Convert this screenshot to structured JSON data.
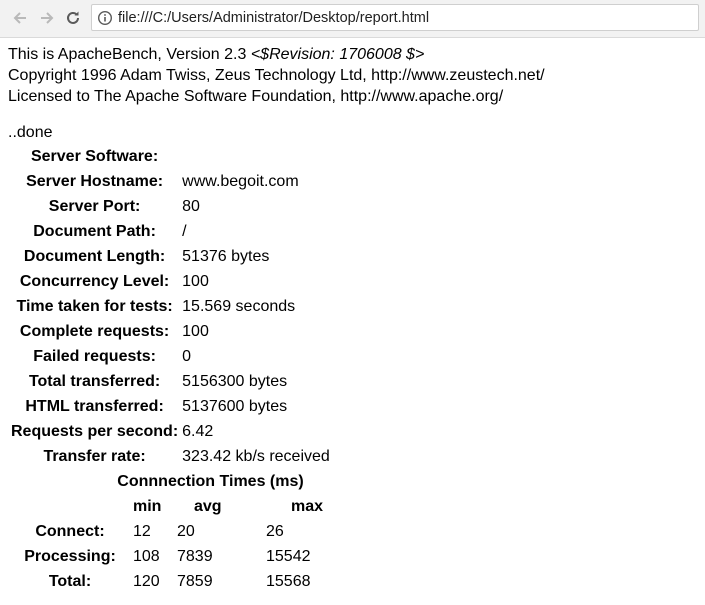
{
  "browser": {
    "url": "file:///C:/Users/Administrator/Desktop/report.html"
  },
  "banner": {
    "line1_prefix": "This is ApacheBench, Version 2.3",
    "revision": "<$Revision: 1706008 $>",
    "line2": "Copyright 1996 Adam Twiss, Zeus Technology Ltd, http://www.zeustech.net/",
    "line3": "Licensed to The Apache Software Foundation, http://www.apache.org/"
  },
  "done": "..done",
  "stats": [
    {
      "label": "Server Software:",
      "value": ""
    },
    {
      "label": "Server Hostname:",
      "value": "www.begoit.com"
    },
    {
      "label": "Server Port:",
      "value": "80"
    },
    {
      "label": "Document Path:",
      "value": "/"
    },
    {
      "label": "Document Length:",
      "value": "51376 bytes"
    },
    {
      "label": "Concurrency Level:",
      "value": "100"
    },
    {
      "label": "Time taken for tests:",
      "value": "15.569 seconds"
    },
    {
      "label": "Complete requests:",
      "value": "100"
    },
    {
      "label": "Failed requests:",
      "value": "0"
    },
    {
      "label": "Total transferred:",
      "value": "5156300 bytes"
    },
    {
      "label": "HTML transferred:",
      "value": "5137600 bytes"
    },
    {
      "label": "Requests per second:",
      "value": "6.42"
    },
    {
      "label": "Transfer rate:",
      "value": "323.42 kb/s received"
    }
  ],
  "connection": {
    "title": "Connnection Times (ms)",
    "headers": [
      "min",
      "avg",
      "max"
    ],
    "rows": [
      {
        "label": "Connect:",
        "min": "12",
        "avg": "20",
        "max": "26"
      },
      {
        "label": "Processing:",
        "min": "108",
        "avg": "7839",
        "max": "15542"
      },
      {
        "label": "Total:",
        "min": "120",
        "avg": "7859",
        "max": "15568"
      }
    ]
  }
}
